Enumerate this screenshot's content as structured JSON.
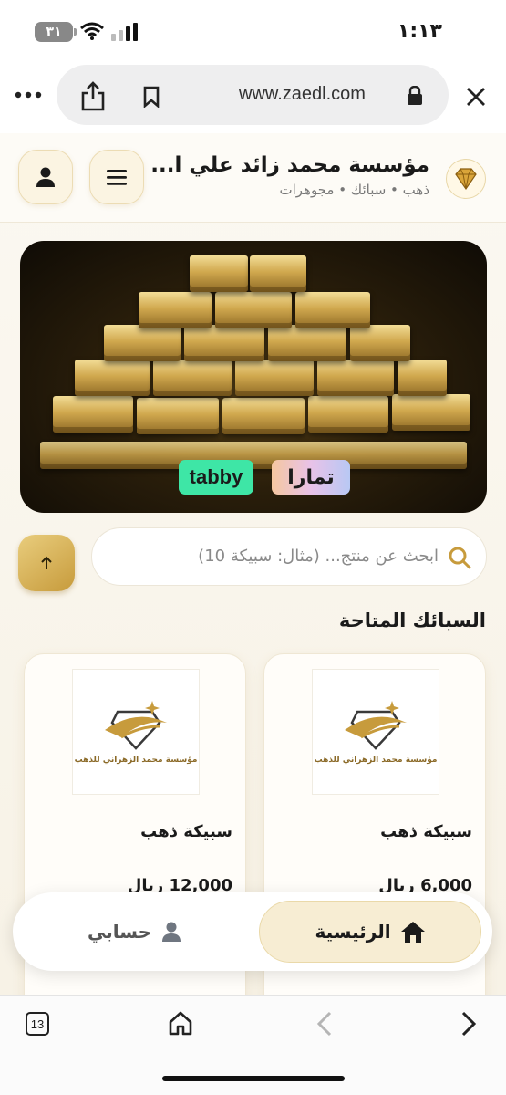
{
  "status_bar": {
    "time": "١:١٣",
    "battery": "٣١"
  },
  "browser": {
    "url": "www.zaedl.com"
  },
  "header": {
    "store_name": "مؤسسة محمد زائد علي ا...",
    "store_subtitle": "ذهب • سبائك • مجوهرات"
  },
  "banner": {
    "tabby_label": "tabby",
    "tamara_label": "تمارا"
  },
  "search": {
    "placeholder": "ابحث عن منتج... (مثال: سبيكة 10)"
  },
  "section": {
    "title": "السبائك المتاحة"
  },
  "products": [
    {
      "logo_text": "مؤسسة محمد الزهراني للذهب",
      "title": "سبيكة ذهب",
      "price": "6,000 ريال"
    },
    {
      "logo_text": "مؤسسة محمد الزهراني للذهب",
      "title": "سبيكة ذهب",
      "price": "12,000 ريال"
    }
  ],
  "bottom_nav": {
    "home_label": "الرئيسية",
    "account_label": "حسابي"
  },
  "toolbar": {
    "tab_count": "13"
  },
  "colors": {
    "gold": "#c79b3c",
    "accent_light": "#f7edd3",
    "tabby": "#3ee6a6"
  }
}
